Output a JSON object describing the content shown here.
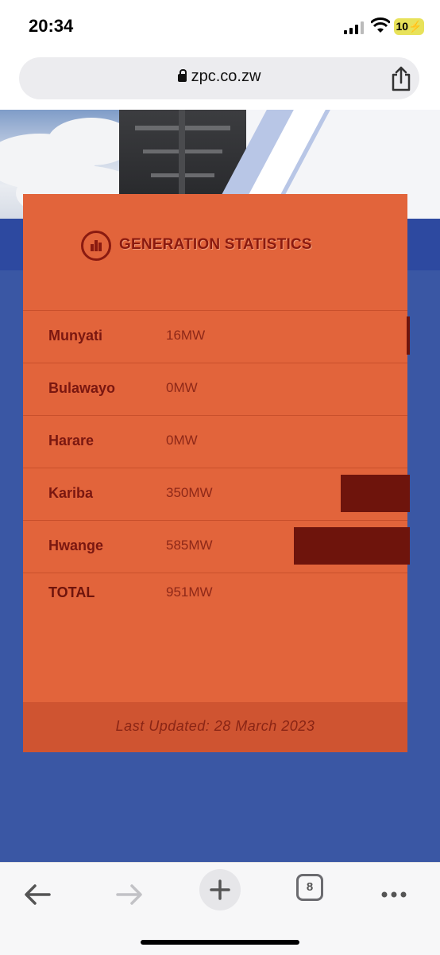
{
  "status_bar": {
    "time": "20:34",
    "battery": "10"
  },
  "browser": {
    "url": "zpc.co.zw",
    "tab_count": "8"
  },
  "stats_card": {
    "title": "GENERATION STATISTICS",
    "rows": [
      {
        "name": "Munyati",
        "value": "16MW",
        "mw": 16
      },
      {
        "name": "Bulawayo",
        "value": "0MW",
        "mw": 0
      },
      {
        "name": "Harare",
        "value": "0MW",
        "mw": 0
      },
      {
        "name": "Kariba",
        "value": "350MW",
        "mw": 350
      },
      {
        "name": "Hwange",
        "value": "585MW",
        "mw": 585
      }
    ],
    "total": {
      "name": "TOTAL",
      "value": "951MW"
    },
    "footer": "Last Updated: 28 March 2023"
  },
  "colors": {
    "card": "#e2643b",
    "bar": "#6e140c",
    "page_bg": "#3a57a4"
  }
}
